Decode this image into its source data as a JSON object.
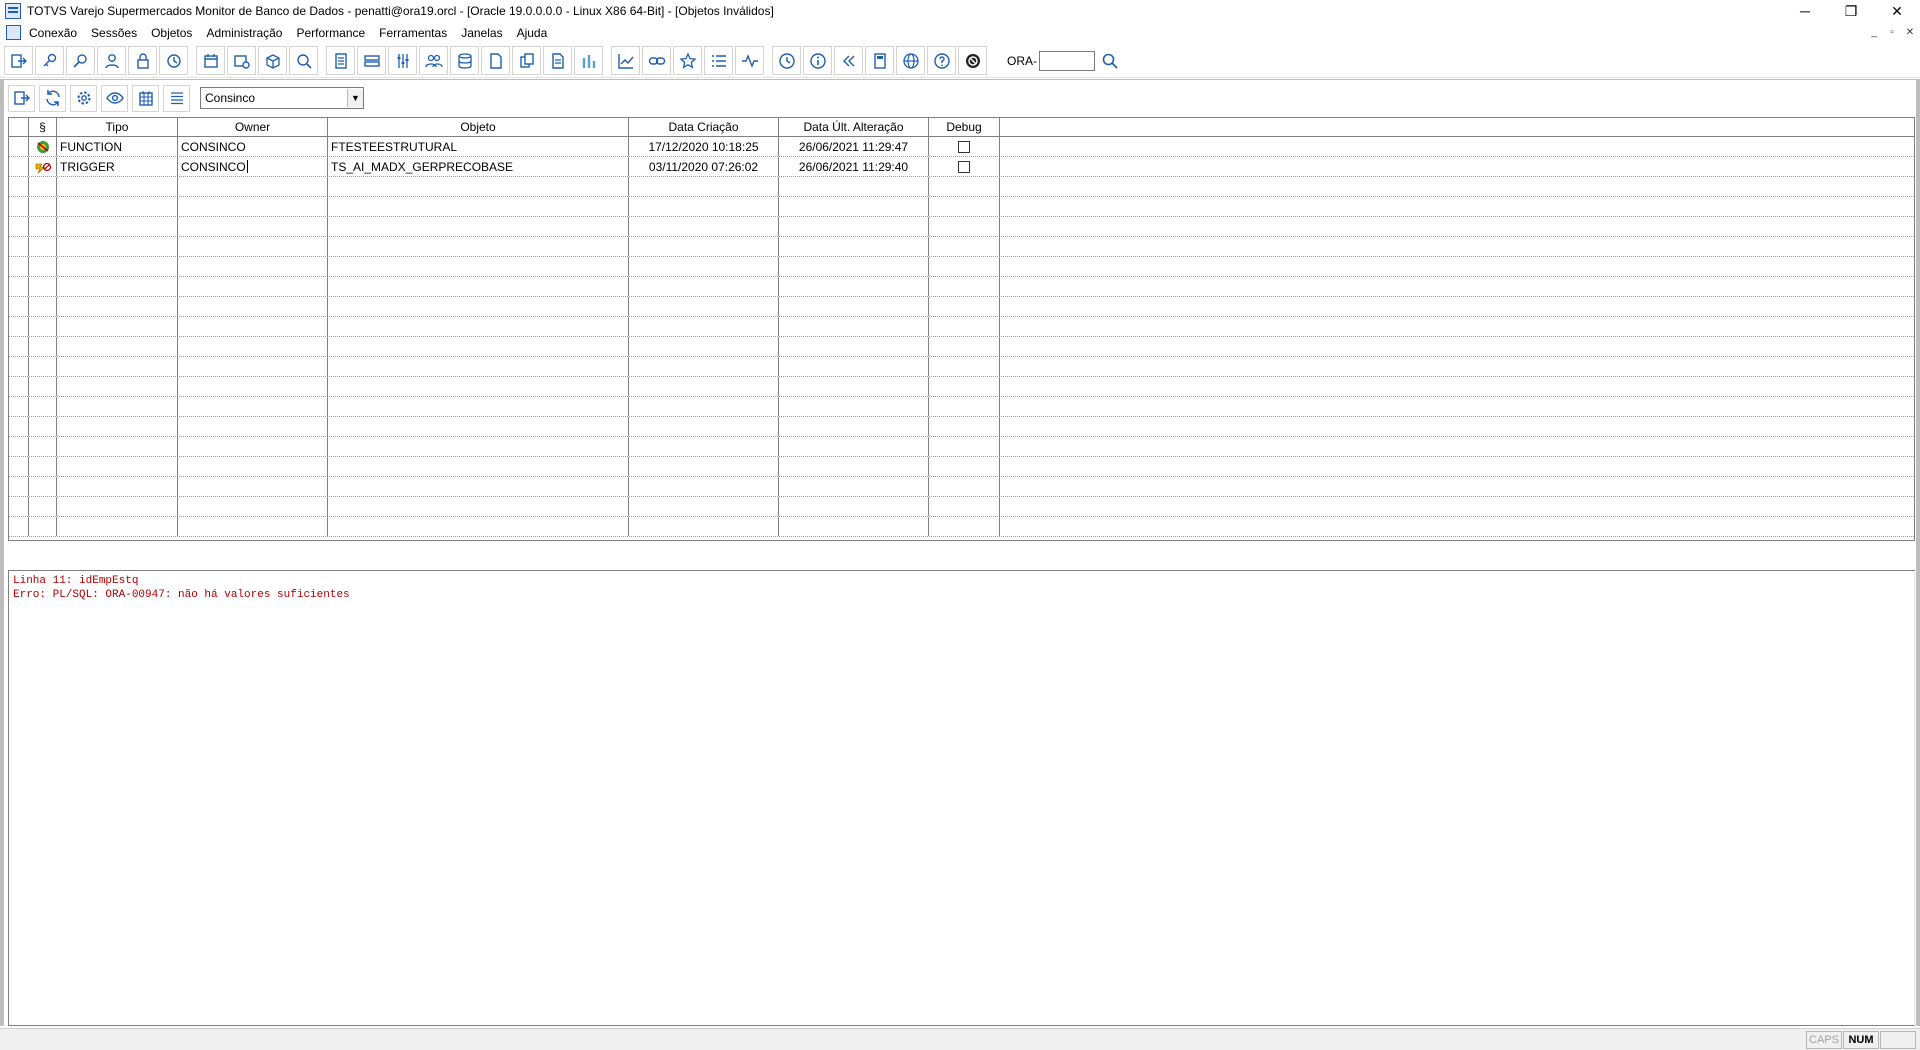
{
  "window": {
    "title": "TOTVS Varejo Supermercados Monitor de Banco de Dados - penatti@ora19.orcl - [Oracle 19.0.0.0.0 - Linux X86 64-Bit] - [Objetos Inválidos]",
    "controls": {
      "minimize": "─",
      "restore": "❐",
      "close": "✕"
    }
  },
  "menu": {
    "items": [
      "Conexão",
      "Sessões",
      "Objetos",
      "Administração",
      "Performance",
      "Ferramentas",
      "Janelas",
      "Ajuda"
    ],
    "mdi": {
      "minimize": "_",
      "restore": "▫",
      "close": "✕"
    }
  },
  "toolbar": {
    "ora_label": "ORA-",
    "ora_value": ""
  },
  "toolbar2": {
    "schema_selected": "Consinco"
  },
  "grid": {
    "columns": {
      "indicator": "",
      "icon": "§",
      "tipo": "Tipo",
      "owner": "Owner",
      "objeto": "Objeto",
      "data_criacao": "Data Criação",
      "data_alteracao": "Data Últ. Alteração",
      "debug": "Debug"
    },
    "rows": [
      {
        "tipo": "FUNCTION",
        "owner": "CONSINCO",
        "objeto": "FTESTEESTRUTURAL",
        "data_criacao": "17/12/2020 10:18:25",
        "data_alteracao": "26/06/2021 11:29:47",
        "debug": false,
        "icon": "function-icon"
      },
      {
        "tipo": "TRIGGER",
        "owner": "CONSINCO",
        "objeto": "TS_AI_MADX_GERPRECOBASE",
        "data_criacao": "03/11/2020 07:26:02",
        "data_alteracao": "26/06/2021 11:29:40",
        "debug": false,
        "icon": "trigger-icon"
      }
    ]
  },
  "errors": {
    "lines": [
      "Linha 11: idEmpEstq",
      "Erro: PL/SQL: ORA-00947: não há valores suficientes"
    ]
  },
  "statusbar": {
    "caps": "CAPS",
    "num": "NUM",
    "scrl": ""
  },
  "colors": {
    "accent": "#1f5fb0",
    "error_text": "#b00000",
    "grid_line": "#808080"
  }
}
